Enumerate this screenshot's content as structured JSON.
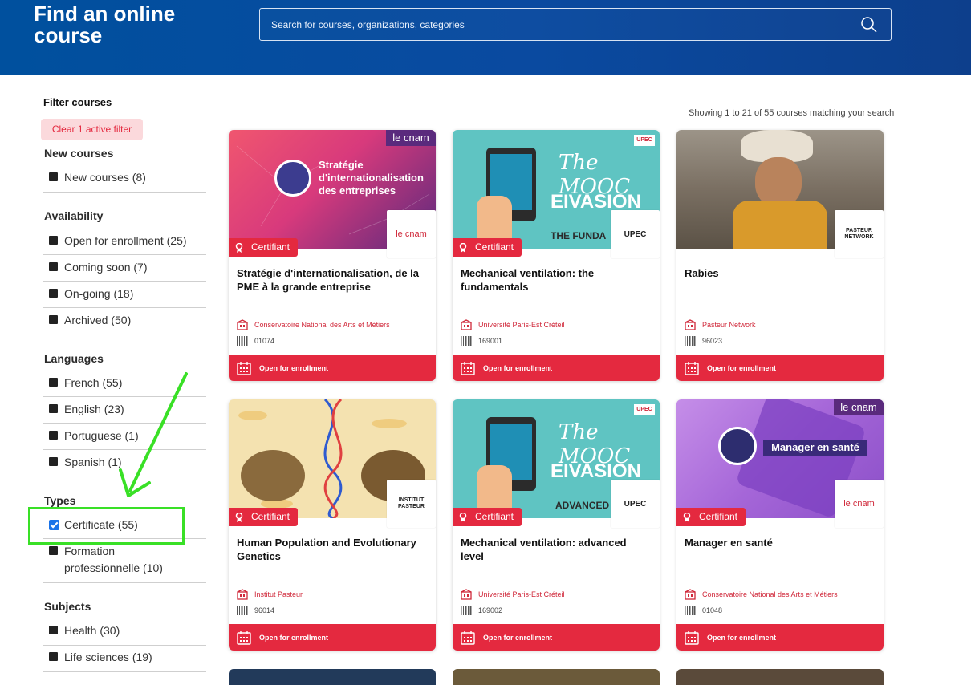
{
  "header": {
    "title": "Find an online course",
    "search_placeholder": "Search for courses, organizations, categories"
  },
  "sidebar": {
    "title": "Filter courses",
    "clear_label": "Clear 1 active filter",
    "groups": [
      {
        "title": "New courses",
        "options": [
          {
            "label": "New courses (8)",
            "checked": false
          }
        ]
      },
      {
        "title": "Availability",
        "options": [
          {
            "label": "Open for enrollment (25)",
            "checked": false
          },
          {
            "label": "Coming soon (7)",
            "checked": false
          },
          {
            "label": "On-going (18)",
            "checked": false
          },
          {
            "label": "Archived (50)",
            "checked": false
          }
        ]
      },
      {
        "title": "Languages",
        "options": [
          {
            "label": "French (55)",
            "checked": false
          },
          {
            "label": "English (23)",
            "checked": false
          },
          {
            "label": "Portuguese (1)",
            "checked": false
          },
          {
            "label": "Spanish (1)",
            "checked": false
          }
        ]
      },
      {
        "title": "Types",
        "options": [
          {
            "label": "Certificate (55)",
            "checked": true
          },
          {
            "label": "Formation professionnelle (10)",
            "checked": false
          }
        ]
      },
      {
        "title": "Subjects",
        "options": [
          {
            "label": "Health (30)",
            "checked": false
          },
          {
            "label": "Life sciences (19)",
            "checked": false
          }
        ]
      }
    ]
  },
  "results": {
    "showing": "Showing 1 to 21 of 55 courses matching your search",
    "cards": [
      {
        "title": "Stratégie d'internationalisation, de la PME à la grande entreprise",
        "org": "Conservatoire National des Arts et Métiers",
        "code": "01074",
        "badge": "Certifiant",
        "status": "Open for enrollment",
        "logo": "le cnam",
        "image_text": "Stratégie d'internationalisation des entreprises",
        "corner_text": "le cnam"
      },
      {
        "title": "Mechanical ventilation: the fundamentals",
        "org": "Université Paris-Est Créteil",
        "code": "169001",
        "badge": "Certifiant",
        "status": "Open for enrollment",
        "logo": "UPEC",
        "image_text": "EIVASION",
        "image_sub": "THE FUNDA",
        "mooc_text": "The MOOC"
      },
      {
        "title": "Rabies",
        "org": "Pasteur Network",
        "code": "96023",
        "badge": "",
        "status": "Open for enrollment",
        "logo": "PASTEUR NETWORK"
      },
      {
        "title": "Human Population and Evolutionary Genetics",
        "org": "Institut Pasteur",
        "code": "96014",
        "badge": "Certifiant",
        "status": "Open for enrollment",
        "logo": "INSTITUT PASTEUR"
      },
      {
        "title": "Mechanical ventilation: advanced level",
        "org": "Université Paris-Est Créteil",
        "code": "169002",
        "badge": "Certifiant",
        "status": "Open for enrollment",
        "logo": "UPEC",
        "image_text": "EIVASION",
        "image_sub": "ADVANCED",
        "mooc_text": "The MOOC"
      },
      {
        "title": "Manager en santé",
        "org": "Conservatoire National des Arts et Métiers",
        "code": "01048",
        "badge": "Certifiant",
        "status": "Open for enrollment",
        "logo": "le cnam",
        "image_text": "Manager en santé",
        "corner_text": "le cnam"
      }
    ]
  },
  "colors": {
    "accent": "#e4293f",
    "header": "#0a4aa0",
    "highlight": "#39e026",
    "checkbox": "#1a73e8"
  }
}
